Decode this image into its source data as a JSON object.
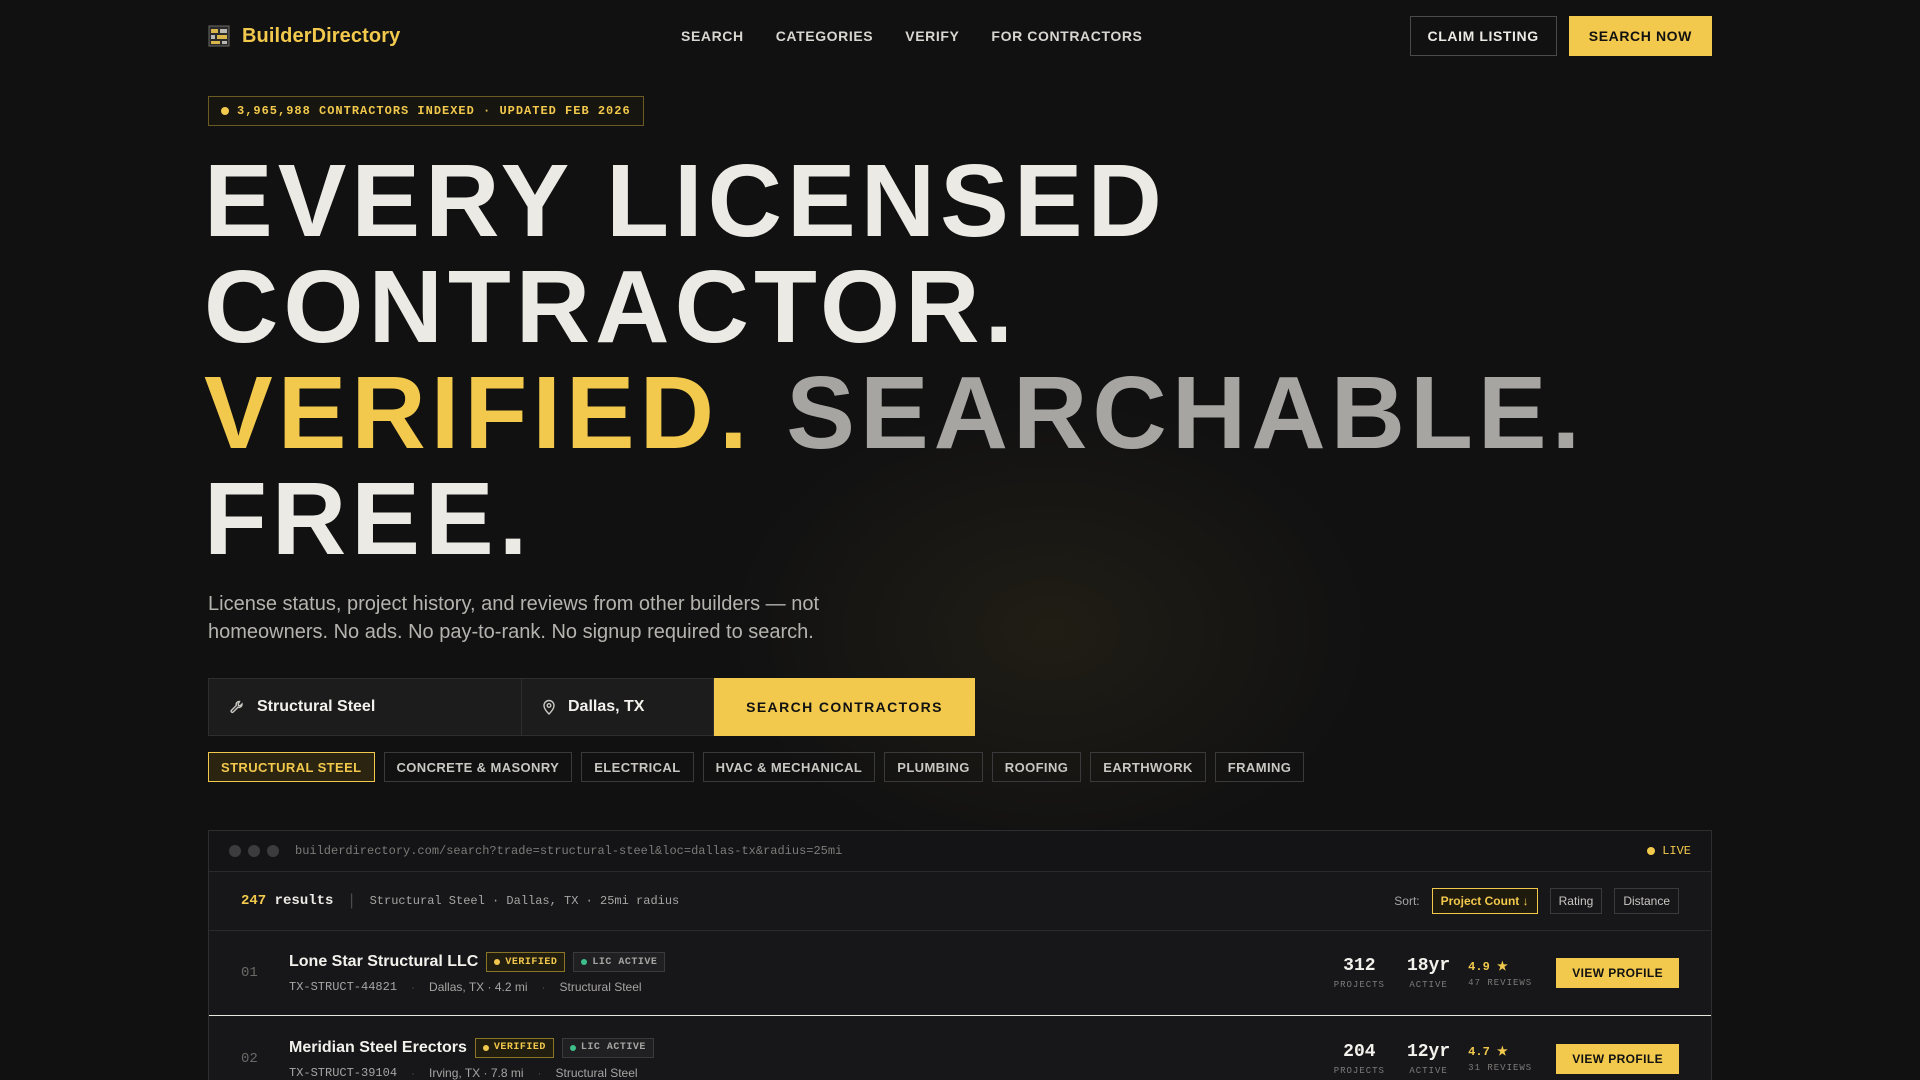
{
  "brand": {
    "name": "BuilderDirectory",
    "icon": "brick-wall-icon"
  },
  "nav": {
    "links": [
      "SEARCH",
      "CATEGORIES",
      "VERIFY",
      "FOR CONTRACTORS"
    ],
    "claim_label": "CLAIM LISTING",
    "search_now_label": "SEARCH NOW"
  },
  "badge": {
    "text": "3,965,988 CONTRACTORS INDEXED · UPDATED FEB 2026"
  },
  "hero": {
    "line1": "EVERY LICENSED",
    "line2": "CONTRACTOR.",
    "verified": "VERIFIED.",
    "searchable": "SEARCHABLE.",
    "free": "FREE."
  },
  "subtitle": "License status, project history, and reviews from other builders — not homeowners. No ads. No pay-to-rank. No signup required to search.",
  "search": {
    "trade_value": "Structural Steel",
    "location_value": "Dallas, TX",
    "button_label": "SEARCH CONTRACTORS"
  },
  "chips": [
    "STRUCTURAL STEEL",
    "CONCRETE & MASONRY",
    "ELECTRICAL",
    "HVAC & MECHANICAL",
    "PLUMBING",
    "ROOFING",
    "EARTHWORK",
    "FRAMING"
  ],
  "panel": {
    "url": "builderdirectory.com/search?trade=structural-steel&loc=dallas-tx&radius=25mi",
    "live_label": "LIVE",
    "results_count": "247",
    "results_word": "results",
    "query_summary": "Structural Steel · Dallas, TX · 25mi radius",
    "sort_label": "Sort:",
    "sort_options": [
      "Project Count ↓",
      "Rating",
      "Distance"
    ]
  },
  "results": [
    {
      "rank": "01",
      "name": "Lone Star Structural LLC",
      "verified_label": "VERIFIED",
      "lic_label": "LIC ACTIVE",
      "license_id": "TX-STRUCT-44821",
      "location": "Dallas, TX · 4.2 mi",
      "trade": "Structural Steel",
      "projects": "312",
      "projects_label": "PROJECTS",
      "active": "18yr",
      "active_label": "ACTIVE",
      "rating": "4.9 ★",
      "reviews": "47 REVIEWS",
      "button": "VIEW PROFILE"
    },
    {
      "rank": "02",
      "name": "Meridian Steel Erectors",
      "verified_label": "VERIFIED",
      "lic_label": "LIC ACTIVE",
      "license_id": "TX-STRUCT-39104",
      "location": "Irving, TX · 7.8 mi",
      "trade": "Structural Steel",
      "projects": "204",
      "projects_label": "PROJECTS",
      "active": "12yr",
      "active_label": "ACTIVE",
      "rating": "4.7 ★",
      "reviews": "31 REVIEWS",
      "button": "VIEW PROFILE"
    }
  ],
  "colors": {
    "accent": "#F2C94C",
    "background": "#111112",
    "text": "#ECEAE4",
    "muted": "#A6A5A2",
    "license_green": "#3DBE8B"
  }
}
